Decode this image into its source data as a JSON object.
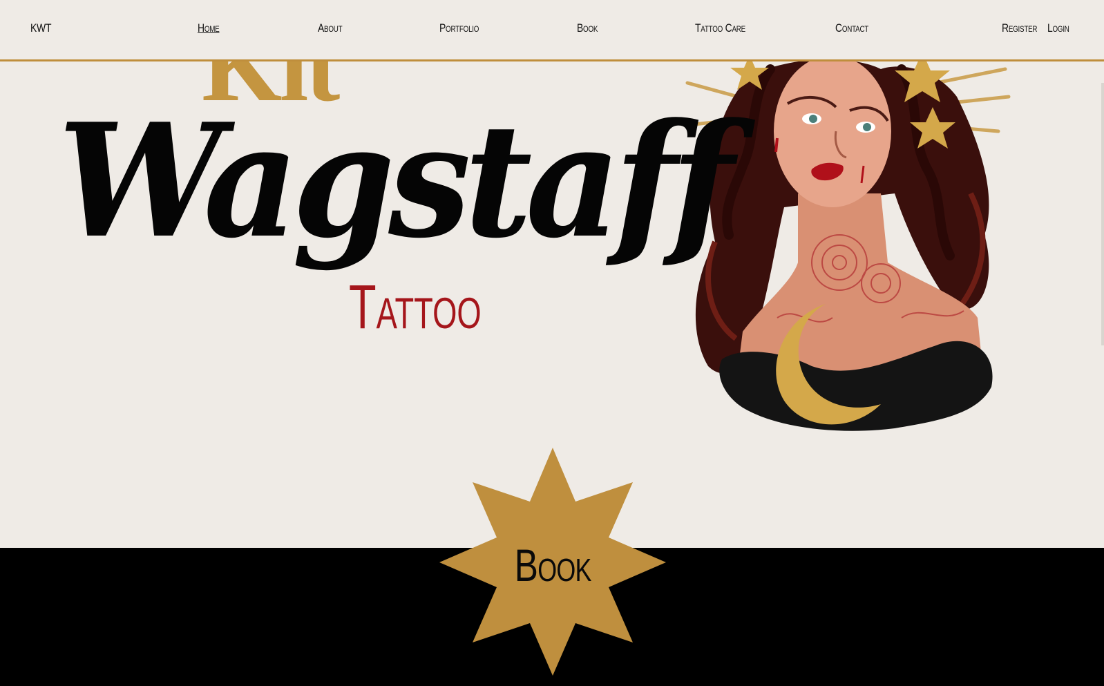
{
  "nav": {
    "brand": "KWT",
    "links": [
      "Home",
      "About",
      "Portfolio",
      "Book",
      "Tattoo Care",
      "Contact"
    ],
    "register": "Register",
    "login": "Login"
  },
  "hero": {
    "kit": "Kit",
    "surname": "Wagstaff",
    "tattoo": "Tattoo"
  },
  "cta": {
    "book_label": "Book"
  },
  "colors": {
    "background": "#efebe6",
    "gold": "#c49540",
    "red": "#a5161b",
    "black": "#000000"
  },
  "icons": [
    "star-burst-icon",
    "moon-icon"
  ]
}
